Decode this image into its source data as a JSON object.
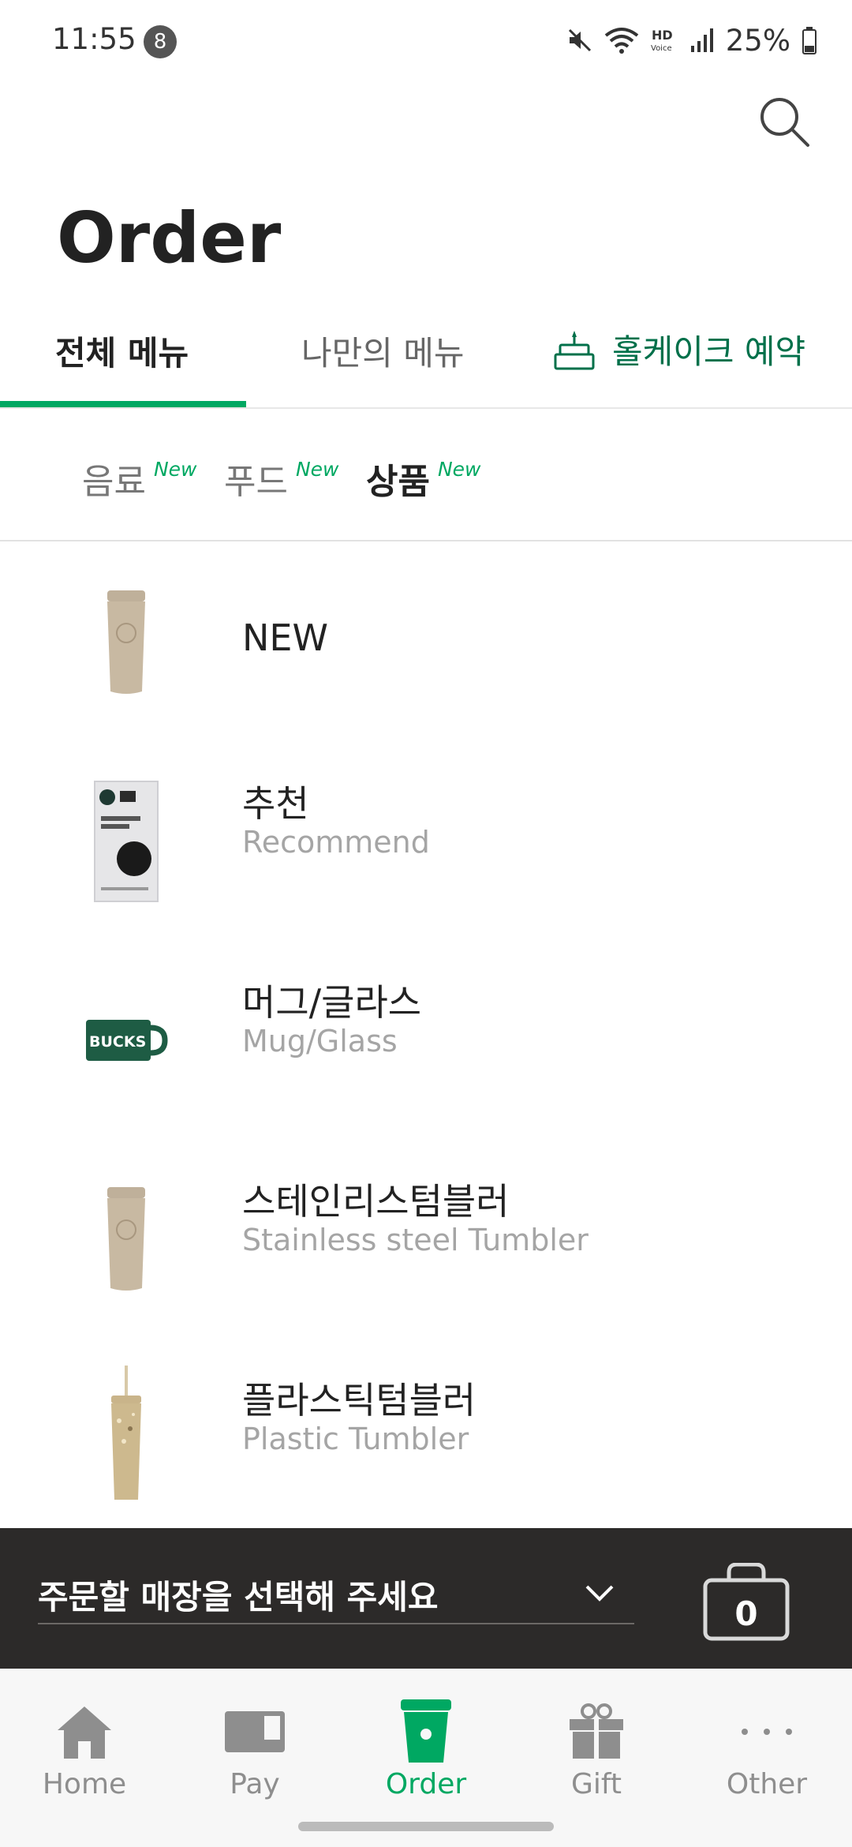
{
  "status_bar": {
    "time": "11:55",
    "notification_count": "8",
    "battery": "25%",
    "icons": [
      "mute-icon",
      "wifi-icon",
      "hd-voice-icon",
      "signal-icon",
      "battery-icon"
    ]
  },
  "header": {
    "title": "Order",
    "search_icon": "search-icon"
  },
  "main_tabs": [
    {
      "label": "전체 메뉴",
      "active": true
    },
    {
      "label": "나만의 메뉴",
      "active": false
    },
    {
      "label": "홀케이크 예약",
      "active": false,
      "icon": "cake-icon"
    }
  ],
  "sub_tabs": [
    {
      "label": "음료",
      "badge": "New",
      "active": false
    },
    {
      "label": "푸드",
      "badge": "New",
      "active": false
    },
    {
      "label": "상품",
      "badge": "New",
      "active": true
    }
  ],
  "categories": [
    {
      "name": "NEW",
      "subtitle": "",
      "thumb": "tumbler-gold-icon"
    },
    {
      "name": "추천",
      "subtitle": "Recommend",
      "thumb": "via-coffee-pack-icon"
    },
    {
      "name": "머그/글라스",
      "subtitle": "Mug/Glass",
      "thumb": "green-mug-icon",
      "mug_text": "BUCKS"
    },
    {
      "name": "스테인리스텀블러",
      "subtitle": "Stainless steel Tumbler",
      "thumb": "tumbler-gold-icon"
    },
    {
      "name": "플라스틱텀블러",
      "subtitle": "Plastic Tumbler",
      "thumb": "glitter-straw-tumbler-icon"
    }
  ],
  "store_bar": {
    "placeholder": "주문할 매장을 선택해 주세요",
    "cart_count": "0"
  },
  "bottom_nav": [
    {
      "label": "Home",
      "icon": "home-icon",
      "active": false
    },
    {
      "label": "Pay",
      "icon": "card-icon",
      "active": false
    },
    {
      "label": "Order",
      "icon": "cup-icon",
      "active": true
    },
    {
      "label": "Gift",
      "icon": "gift-icon",
      "active": false
    },
    {
      "label": "Other",
      "icon": "more-dots-icon",
      "active": false
    }
  ],
  "colors": {
    "accent_green": "#00a862",
    "dark_green": "#00704a",
    "store_bar_bg": "#2c2a29"
  }
}
